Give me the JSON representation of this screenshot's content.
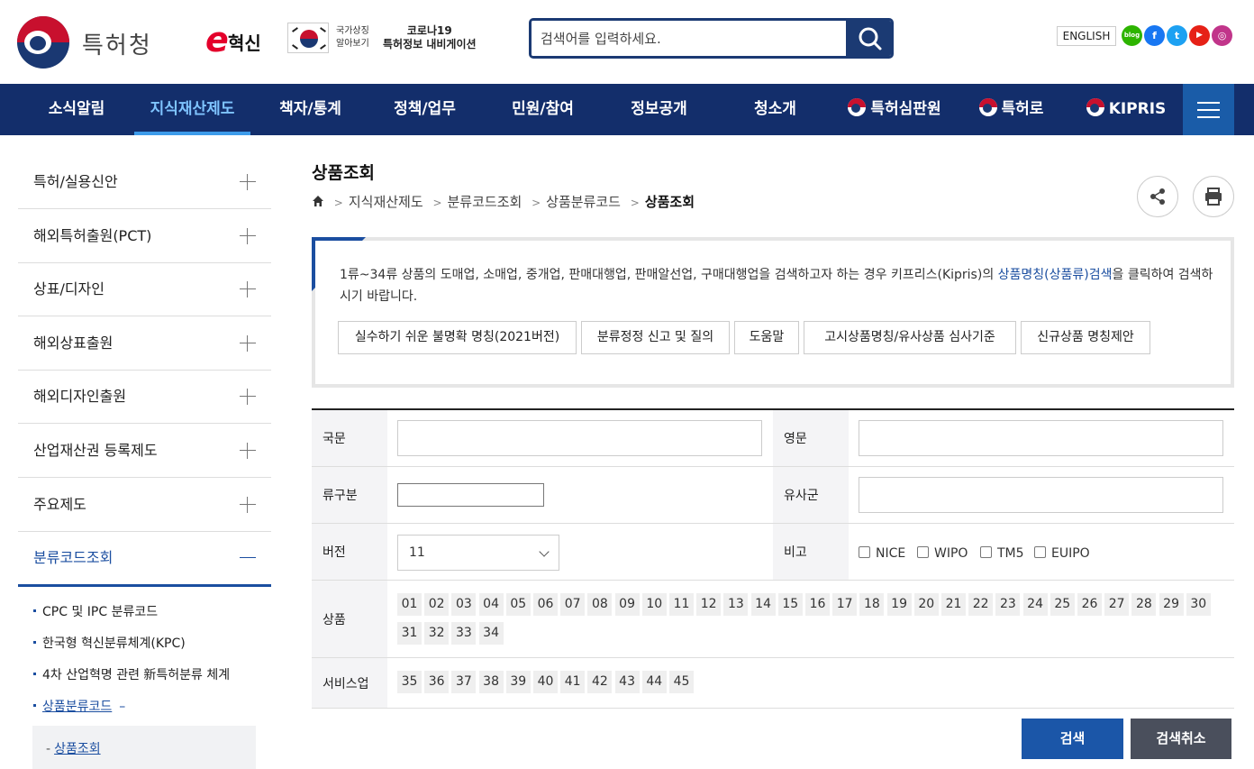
{
  "header": {
    "logo_text": "특허청",
    "einnov_e": "e",
    "einnov_text": "혁신",
    "national_symbol_text": "국가상징\n알아보기",
    "covid_text": "코로나19\n특허정보 내비게이션",
    "search_placeholder": "검색어를 입력하세요.",
    "english_label": "ENGLISH",
    "sns": [
      {
        "name": "blog",
        "label": "blog",
        "color": "#2db400"
      },
      {
        "name": "facebook",
        "label": "f",
        "color": "#1877f2"
      },
      {
        "name": "twitter",
        "label": "t",
        "color": "#1da1f2"
      },
      {
        "name": "youtube",
        "label": "▶",
        "color": "#e62117"
      },
      {
        "name": "instagram",
        "label": "◎",
        "color": "#c1358a"
      }
    ]
  },
  "gnb": {
    "items": [
      {
        "label": "소식알림"
      },
      {
        "label": "지식재산제도"
      },
      {
        "label": "책자/통계"
      },
      {
        "label": "정책/업무"
      },
      {
        "label": "민원/참여"
      },
      {
        "label": "정보공개"
      },
      {
        "label": "청소개"
      },
      {
        "label": "특허심판원"
      },
      {
        "label": "특허로"
      },
      {
        "label": "KIPRIS"
      }
    ],
    "active_index": 1
  },
  "sidebar": {
    "items": [
      {
        "label": "특허/실용신안"
      },
      {
        "label": "해외특허출원(PCT)"
      },
      {
        "label": "상표/디자인"
      },
      {
        "label": "해외상표출원"
      },
      {
        "label": "해외디자인출원"
      },
      {
        "label": "산업재산권 등록제도"
      },
      {
        "label": "주요제도"
      },
      {
        "label": "분류코드조회"
      }
    ],
    "sub_items": [
      {
        "label": "CPC 및 IPC 분류코드"
      },
      {
        "label": "한국형 혁신분류체계(KPC)"
      },
      {
        "label": "4차 산업혁명 관련 新특허분류 체계"
      },
      {
        "label": "상품분류코드"
      }
    ],
    "sub3_label": "상품조회"
  },
  "content": {
    "title": "상품조회",
    "breadcrumb": [
      "지식재산제도",
      "분류코드조회",
      "상품분류코드",
      "상품조회"
    ],
    "info": {
      "text_before": "1류~34류 상품의 도매업, 소매업, 중개업, 판매대행업, 판매알선업, 구매대행업을 검색하고자 하는 경우 키프리스(Kipris)의 ",
      "link": "상품명칭(상품류)검색",
      "text_after": "을 클릭하여 검색하시기 바랍니다.",
      "buttons": [
        {
          "label": "실수하기 쉬운 불명확 명칭(2021버전)"
        },
        {
          "label": "분류정정 신고 및 질의"
        },
        {
          "label": "도움말"
        },
        {
          "label": "고시상품명칭/유사상품 심사기준"
        },
        {
          "label": "신규상품 명칭제안"
        }
      ]
    },
    "form": {
      "korean_label": "국문",
      "english_label": "영문",
      "class_label": "류구분",
      "similar_label": "유사군",
      "version_label": "버전",
      "version_value": "11",
      "note_label": "비고",
      "checkboxes": [
        "NICE",
        "WIPO",
        "TM5",
        "EUIPO"
      ],
      "goods_label": "상품",
      "goods_classes": [
        "01",
        "02",
        "03",
        "04",
        "05",
        "06",
        "07",
        "08",
        "09",
        "10",
        "11",
        "12",
        "13",
        "14",
        "15",
        "16",
        "17",
        "18",
        "19",
        "20",
        "21",
        "22",
        "23",
        "24",
        "25",
        "26",
        "27",
        "28",
        "29",
        "30",
        "31",
        "32",
        "33",
        "34"
      ],
      "services_label": "서비스업",
      "service_classes": [
        "35",
        "36",
        "37",
        "38",
        "39",
        "40",
        "41",
        "42",
        "43",
        "44",
        "45"
      ]
    },
    "search_button": "검색",
    "cancel_button": "검색취소"
  }
}
